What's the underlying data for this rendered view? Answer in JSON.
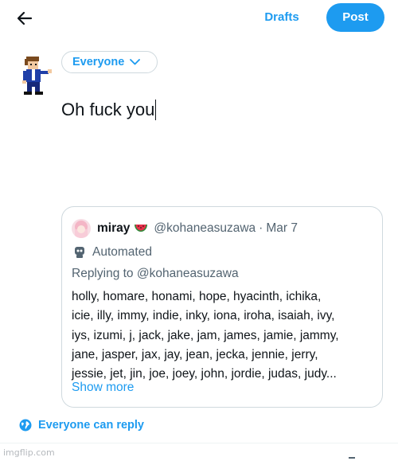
{
  "header": {
    "back_icon": "arrow-left-icon",
    "drafts_label": "Drafts",
    "post_label": "Post"
  },
  "composer": {
    "audience_label": "Everyone",
    "audience_icon": "chevron-down-icon",
    "text": "Oh fuck you",
    "avatar_icon": "pixel-character-avatar"
  },
  "quote": {
    "name": "miray",
    "name_emoji": "watermelon-icon",
    "handle": "@kohaneasuzawa",
    "separator": "·",
    "date": "Mar 7",
    "automated_label": "Automated",
    "replying_prefix": "Replying to",
    "replying_handle": "@kohaneasuzawa",
    "body_lines": [
      "holly, homare, honami, hope, hyacinth, ichika,",
      "icie, illy, immy, indie, inky, iona, iroha, isaiah, ivy,",
      "iys, izumi, j, jack, jake, jam, james, jamie, jammy,",
      "jane, jasper, jax, jay, jean, jecka, jennie, jerry,",
      "jessie, jet, jin, joe, joey, john, jordie, judas, judy..."
    ],
    "show_more": "Show more"
  },
  "reply_setting": {
    "label": "Everyone can reply",
    "icon": "globe-icon"
  },
  "watermark": "imgflip.com",
  "colors": {
    "accent": "#1d9bf0",
    "text": "#0f1419",
    "secondary": "#536471",
    "border": "#cfd9de"
  }
}
